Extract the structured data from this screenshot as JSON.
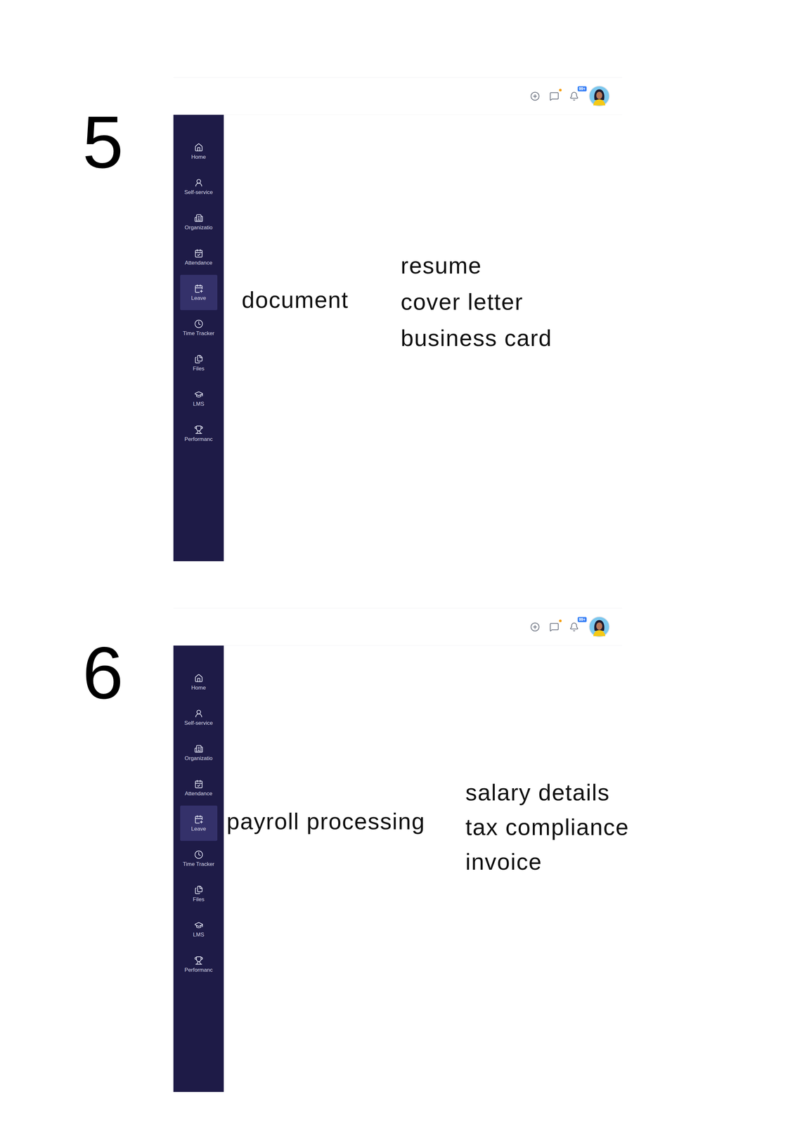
{
  "app": {
    "topbar": {
      "notification_badge": "99+"
    },
    "sidebar": {
      "items": [
        {
          "label": "Home",
          "selected": false
        },
        {
          "label": "Self-service",
          "selected": false
        },
        {
          "label": "Organizatio",
          "selected": false
        },
        {
          "label": "Attendance",
          "selected": false
        },
        {
          "label": "Leave",
          "selected": true
        },
        {
          "label": "Time Tracker",
          "selected": false
        },
        {
          "label": "Files",
          "selected": false
        },
        {
          "label": "LMS",
          "selected": false
        },
        {
          "label": "Performanc",
          "selected": false
        }
      ]
    }
  },
  "sections": [
    {
      "number": "5",
      "main_label": "document",
      "related_labels": [
        "resume",
        "cover letter",
        "business card"
      ]
    },
    {
      "number": "6",
      "main_label": "payroll processing",
      "related_labels": [
        "salary details",
        "tax compliance",
        "invoice"
      ]
    }
  ]
}
